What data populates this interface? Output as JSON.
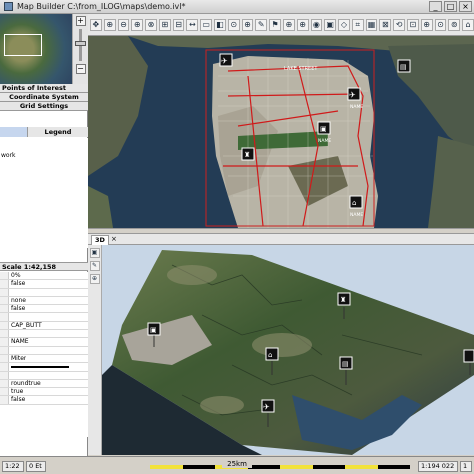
{
  "window": {
    "title": "Map Builder C:\\from_ILOG\\maps\\demo.ivl*",
    "min": "_",
    "max": "□",
    "close": "×"
  },
  "left_panel": {
    "zoom_in": "+",
    "zoom_out": "−",
    "tabs": {
      "points_of_interest": "Points of Interest",
      "coordinate_system": "Coordinate System",
      "grid_settings": "Grid Settings",
      "legend": "Legend"
    },
    "layer_tree_items": [
      "work"
    ],
    "property_header": "Scale 1:42,158",
    "properties": [
      "0%",
      "false",
      "",
      "none",
      "false",
      "",
      "CAP_BUTT",
      "",
      "NAME",
      "",
      "Miter",
      "",
      "roundtrue",
      "true",
      "false"
    ]
  },
  "toolbar": {
    "buttons": [
      "✥",
      "⊕",
      "⊖",
      "⊕",
      "⊗",
      "⊞",
      "⊟",
      "↔",
      "▭",
      "◧",
      "⊙",
      "⊕",
      "✎",
      "⚑",
      "⊕",
      "⊕",
      "◉",
      "▣",
      "◇",
      "⌗",
      "▦",
      "⊠",
      "⟲",
      "⊡",
      "⊕",
      "⊙",
      "⊚",
      "⌂"
    ]
  },
  "map2d": {
    "place_labels": [
      "LAKE STREET",
      "NAME",
      "NAME",
      "NAME"
    ]
  },
  "view3d": {
    "tab": "3D",
    "close": "×",
    "side_tools": [
      "▣",
      "✎",
      "⊕"
    ]
  },
  "status": {
    "left": "1:22",
    "coord": "0  Et",
    "scale_label": "25km",
    "scale_ratio": "1:194 022",
    "page": "1"
  },
  "colors": {
    "water": "#233c55",
    "land_3d_sky": "#c7d6e6",
    "route_red": "#d01a1a",
    "scale_yellow": "#f2e23a"
  }
}
